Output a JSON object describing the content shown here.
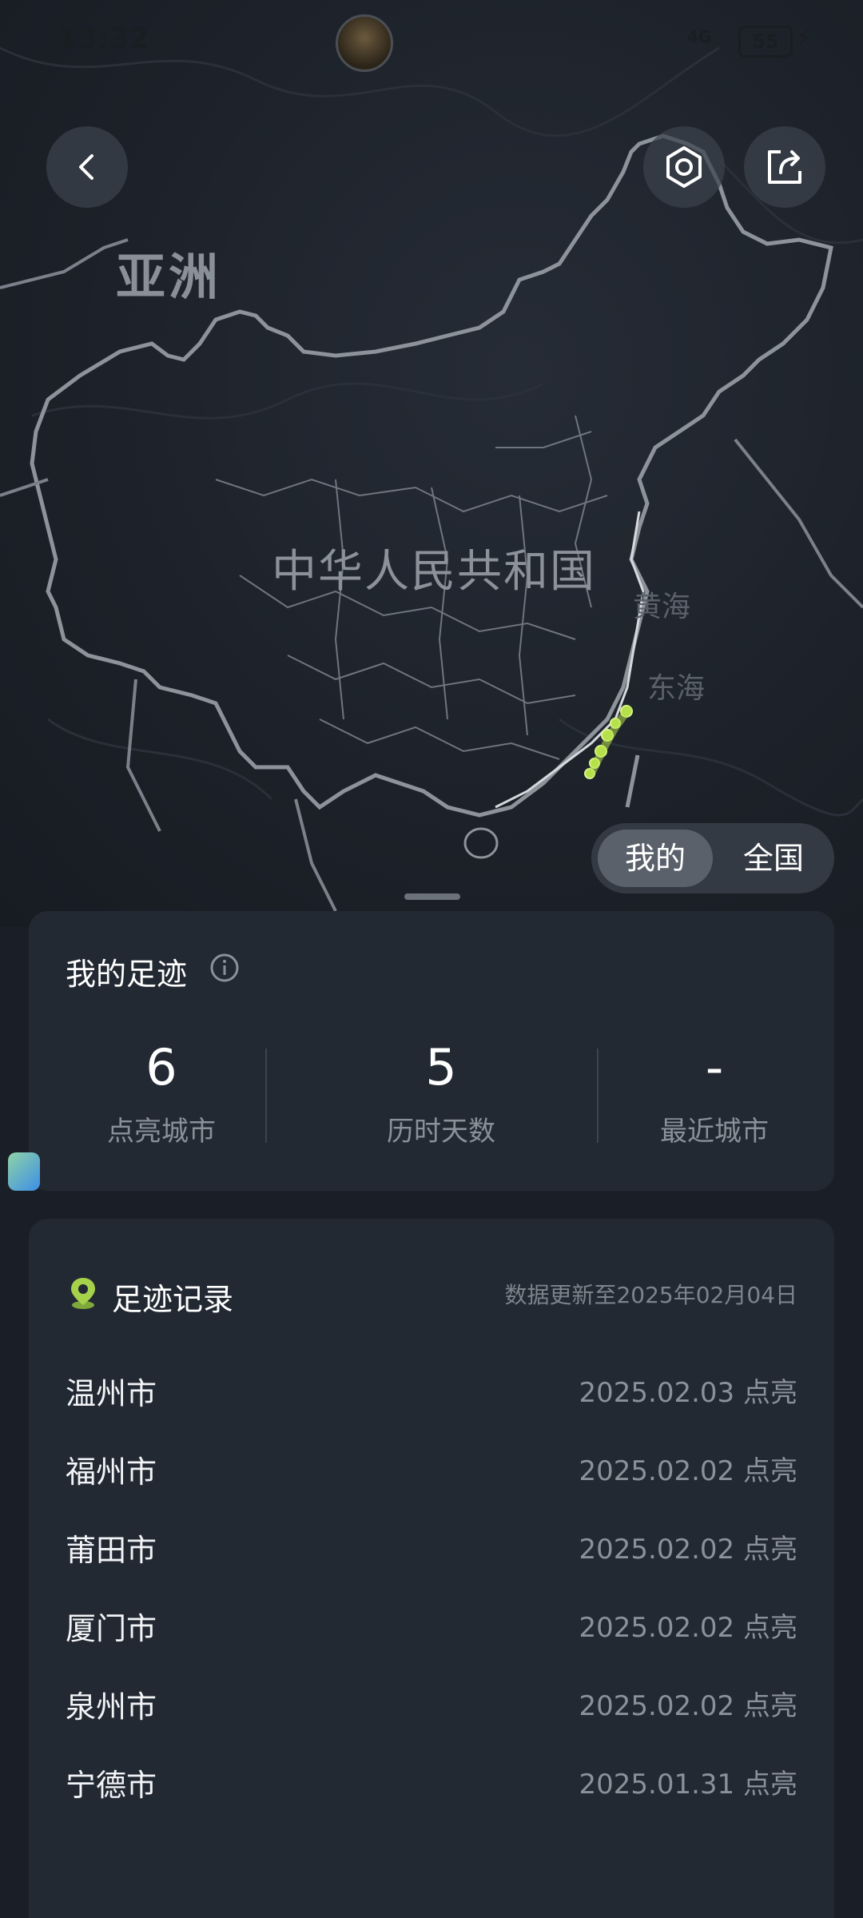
{
  "status_bar": {
    "time": "13:32",
    "network": "4G",
    "battery": "55"
  },
  "map": {
    "continent_label": "亚洲",
    "country_label": "中华人民共和国",
    "sea_labels": [
      "黄海",
      "东海"
    ],
    "highlight_color": "#b6e04a"
  },
  "toolbar": {
    "back_icon": "back-icon",
    "settings_icon": "settings-icon",
    "share_icon": "share-icon"
  },
  "toggle": {
    "options": [
      "我的",
      "全国"
    ],
    "selected": "我的"
  },
  "stats": {
    "title": "我的足迹",
    "items": [
      {
        "value": "6",
        "label": "点亮城市"
      },
      {
        "value": "5",
        "label": "历时天数"
      },
      {
        "value": "-",
        "label": "最近城市"
      }
    ]
  },
  "records": {
    "title": "足迹记录",
    "updated": "数据更新至2025年02月04日",
    "items": [
      {
        "city": "温州市",
        "date": "2025.02.03 点亮"
      },
      {
        "city": "福州市",
        "date": "2025.02.02 点亮"
      },
      {
        "city": "莆田市",
        "date": "2025.02.02 点亮"
      },
      {
        "city": "厦门市",
        "date": "2025.02.02 点亮"
      },
      {
        "city": "泉州市",
        "date": "2025.02.02 点亮"
      },
      {
        "city": "宁德市",
        "date": "2025.01.31 点亮"
      }
    ]
  },
  "colors": {
    "background": "#1a1f27",
    "card": "#232933",
    "accent_green": "#b6e04a"
  }
}
